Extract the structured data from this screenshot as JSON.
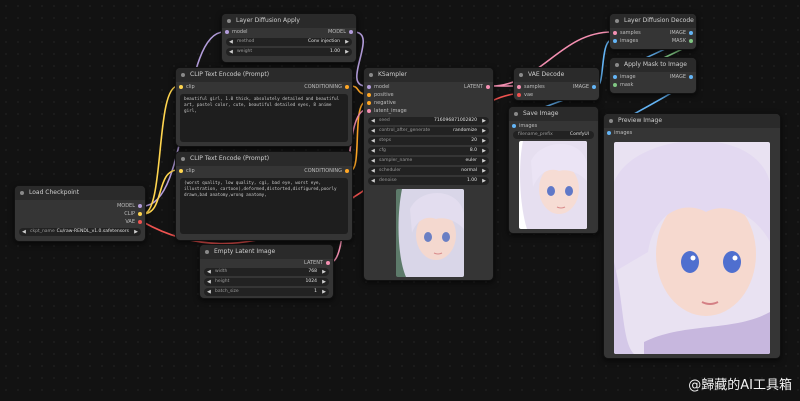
{
  "colors": {
    "model": "#b39ddb",
    "clip": "#ffd54f",
    "vae": "#ef5350",
    "conditioning": "#ffa726",
    "latent": "#f48fb1",
    "image": "#64b5f6",
    "mask": "#81c784"
  },
  "nodes": {
    "layer_diffusion_apply": {
      "title": "Layer Diffusion Apply",
      "input_model": "model",
      "output_model": "MODEL",
      "method_label": "method",
      "method_value": "Conv injection",
      "weight_label": "weight",
      "weight_value": "1.00"
    },
    "clip_pos": {
      "title": "CLIP Text Encode (Prompt)",
      "input_clip": "clip",
      "output": "CONDITIONING",
      "text": "beautiful girl, 1.0 thick, absolutely detailed and beautiful art, pastel color, cute, beautiful detailed eyes, 8 anime girl,"
    },
    "clip_neg": {
      "title": "CLIP Text Encode (Prompt)",
      "input_clip": "clip",
      "output": "CONDITIONING",
      "text": "(worst quality, low quality, cgi, bad eye, worst eye, illustration, cartoon),deformed,distorted,disfigured,poorly drawn,bad anatomy,wrong anatomy,"
    },
    "load_checkpoint": {
      "title": "Load Checkpoint",
      "out_model": "MODEL",
      "out_clip": "CLIP",
      "out_vae": "VAE",
      "ckpt_label": "ckpt_name",
      "ckpt_value": "Cu/raw-RENDL_v1.0.safetensors"
    },
    "ksampler": {
      "title": "KSampler",
      "in_model": "model",
      "in_positive": "positive",
      "in_negative": "negative",
      "in_latent": "latent_image",
      "out_latent": "LATENT",
      "widgets": [
        {
          "label": "seed",
          "value": "716096871002820"
        },
        {
          "label": "control_after_generate",
          "value": "randomize"
        },
        {
          "label": "steps",
          "value": "20"
        },
        {
          "label": "cfg",
          "value": "8.0"
        },
        {
          "label": "sampler_name",
          "value": "euler"
        },
        {
          "label": "scheduler",
          "value": "normal"
        },
        {
          "label": "denoise",
          "value": "1.00"
        }
      ]
    },
    "empty_latent": {
      "title": "Empty Latent Image",
      "out_latent": "LATENT",
      "widgets": [
        {
          "label": "width",
          "value": "768"
        },
        {
          "label": "height",
          "value": "1024"
        },
        {
          "label": "batch_size",
          "value": "1"
        }
      ]
    },
    "vae_decode": {
      "title": "VAE Decode",
      "in_samples": "samples",
      "in_vae": "vae",
      "out_image": "IMAGE"
    },
    "save_image": {
      "title": "Save Image",
      "in_images": "images",
      "prefix_label": "filename_prefix",
      "prefix_value": "ComfyUI"
    },
    "layer_diffusion_decode": {
      "title": "Layer Diffusion Decode",
      "in_samples": "samples",
      "in_images": "images",
      "out_image": "IMAGE",
      "out_mask": "MASK"
    },
    "apply_mask": {
      "title": "Apply Mask to Image",
      "in_image": "image",
      "in_mask": "mask",
      "out_image": "IMAGE"
    },
    "preview_image": {
      "title": "Preview Image",
      "in_images": "images"
    }
  },
  "watermark": "@歸藏的AI工具箱"
}
